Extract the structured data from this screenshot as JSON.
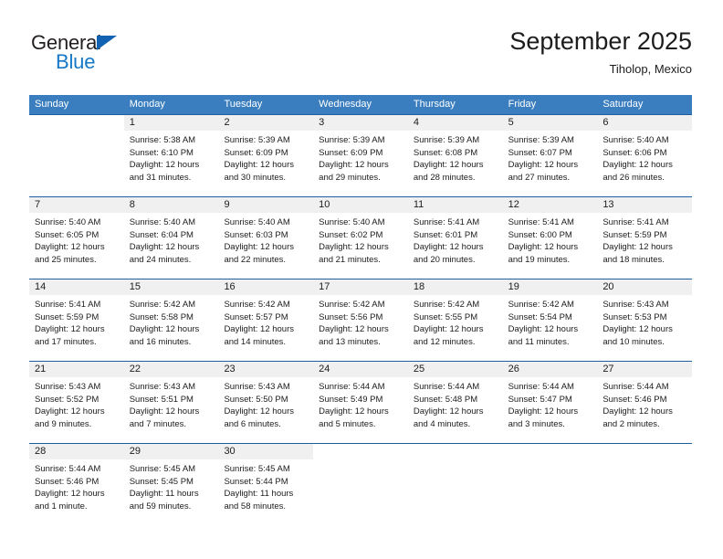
{
  "brand": {
    "name_part1": "General",
    "name_part2": "Blue",
    "triangle_color": "#1262b3",
    "blue_color": "#1678c8"
  },
  "header": {
    "month_title": "September 2025",
    "location": "Tiholop, Mexico"
  },
  "theme": {
    "header_row_bg": "#3a7ebf",
    "week_divider": "#1f5fa0",
    "day_band_bg": "#f0f0f0",
    "text": "#1c1c1c"
  },
  "weekdays": [
    "Sunday",
    "Monday",
    "Tuesday",
    "Wednesday",
    "Thursday",
    "Friday",
    "Saturday"
  ],
  "weeks": [
    {
      "days": [
        {
          "num": "",
          "empty": true,
          "lines": [
            "",
            "",
            "",
            ""
          ]
        },
        {
          "num": "1",
          "empty": false,
          "lines": [
            "Sunrise: 5:38 AM",
            "Sunset: 6:10 PM",
            "Daylight: 12 hours",
            "and 31 minutes."
          ]
        },
        {
          "num": "2",
          "empty": false,
          "lines": [
            "Sunrise: 5:39 AM",
            "Sunset: 6:09 PM",
            "Daylight: 12 hours",
            "and 30 minutes."
          ]
        },
        {
          "num": "3",
          "empty": false,
          "lines": [
            "Sunrise: 5:39 AM",
            "Sunset: 6:09 PM",
            "Daylight: 12 hours",
            "and 29 minutes."
          ]
        },
        {
          "num": "4",
          "empty": false,
          "lines": [
            "Sunrise: 5:39 AM",
            "Sunset: 6:08 PM",
            "Daylight: 12 hours",
            "and 28 minutes."
          ]
        },
        {
          "num": "5",
          "empty": false,
          "lines": [
            "Sunrise: 5:39 AM",
            "Sunset: 6:07 PM",
            "Daylight: 12 hours",
            "and 27 minutes."
          ]
        },
        {
          "num": "6",
          "empty": false,
          "lines": [
            "Sunrise: 5:40 AM",
            "Sunset: 6:06 PM",
            "Daylight: 12 hours",
            "and 26 minutes."
          ]
        }
      ]
    },
    {
      "days": [
        {
          "num": "7",
          "empty": false,
          "lines": [
            "Sunrise: 5:40 AM",
            "Sunset: 6:05 PM",
            "Daylight: 12 hours",
            "and 25 minutes."
          ]
        },
        {
          "num": "8",
          "empty": false,
          "lines": [
            "Sunrise: 5:40 AM",
            "Sunset: 6:04 PM",
            "Daylight: 12 hours",
            "and 24 minutes."
          ]
        },
        {
          "num": "9",
          "empty": false,
          "lines": [
            "Sunrise: 5:40 AM",
            "Sunset: 6:03 PM",
            "Daylight: 12 hours",
            "and 22 minutes."
          ]
        },
        {
          "num": "10",
          "empty": false,
          "lines": [
            "Sunrise: 5:40 AM",
            "Sunset: 6:02 PM",
            "Daylight: 12 hours",
            "and 21 minutes."
          ]
        },
        {
          "num": "11",
          "empty": false,
          "lines": [
            "Sunrise: 5:41 AM",
            "Sunset: 6:01 PM",
            "Daylight: 12 hours",
            "and 20 minutes."
          ]
        },
        {
          "num": "12",
          "empty": false,
          "lines": [
            "Sunrise: 5:41 AM",
            "Sunset: 6:00 PM",
            "Daylight: 12 hours",
            "and 19 minutes."
          ]
        },
        {
          "num": "13",
          "empty": false,
          "lines": [
            "Sunrise: 5:41 AM",
            "Sunset: 5:59 PM",
            "Daylight: 12 hours",
            "and 18 minutes."
          ]
        }
      ]
    },
    {
      "days": [
        {
          "num": "14",
          "empty": false,
          "lines": [
            "Sunrise: 5:41 AM",
            "Sunset: 5:59 PM",
            "Daylight: 12 hours",
            "and 17 minutes."
          ]
        },
        {
          "num": "15",
          "empty": false,
          "lines": [
            "Sunrise: 5:42 AM",
            "Sunset: 5:58 PM",
            "Daylight: 12 hours",
            "and 16 minutes."
          ]
        },
        {
          "num": "16",
          "empty": false,
          "lines": [
            "Sunrise: 5:42 AM",
            "Sunset: 5:57 PM",
            "Daylight: 12 hours",
            "and 14 minutes."
          ]
        },
        {
          "num": "17",
          "empty": false,
          "lines": [
            "Sunrise: 5:42 AM",
            "Sunset: 5:56 PM",
            "Daylight: 12 hours",
            "and 13 minutes."
          ]
        },
        {
          "num": "18",
          "empty": false,
          "lines": [
            "Sunrise: 5:42 AM",
            "Sunset: 5:55 PM",
            "Daylight: 12 hours",
            "and 12 minutes."
          ]
        },
        {
          "num": "19",
          "empty": false,
          "lines": [
            "Sunrise: 5:42 AM",
            "Sunset: 5:54 PM",
            "Daylight: 12 hours",
            "and 11 minutes."
          ]
        },
        {
          "num": "20",
          "empty": false,
          "lines": [
            "Sunrise: 5:43 AM",
            "Sunset: 5:53 PM",
            "Daylight: 12 hours",
            "and 10 minutes."
          ]
        }
      ]
    },
    {
      "days": [
        {
          "num": "21",
          "empty": false,
          "lines": [
            "Sunrise: 5:43 AM",
            "Sunset: 5:52 PM",
            "Daylight: 12 hours",
            "and 9 minutes."
          ]
        },
        {
          "num": "22",
          "empty": false,
          "lines": [
            "Sunrise: 5:43 AM",
            "Sunset: 5:51 PM",
            "Daylight: 12 hours",
            "and 7 minutes."
          ]
        },
        {
          "num": "23",
          "empty": false,
          "lines": [
            "Sunrise: 5:43 AM",
            "Sunset: 5:50 PM",
            "Daylight: 12 hours",
            "and 6 minutes."
          ]
        },
        {
          "num": "24",
          "empty": false,
          "lines": [
            "Sunrise: 5:44 AM",
            "Sunset: 5:49 PM",
            "Daylight: 12 hours",
            "and 5 minutes."
          ]
        },
        {
          "num": "25",
          "empty": false,
          "lines": [
            "Sunrise: 5:44 AM",
            "Sunset: 5:48 PM",
            "Daylight: 12 hours",
            "and 4 minutes."
          ]
        },
        {
          "num": "26",
          "empty": false,
          "lines": [
            "Sunrise: 5:44 AM",
            "Sunset: 5:47 PM",
            "Daylight: 12 hours",
            "and 3 minutes."
          ]
        },
        {
          "num": "27",
          "empty": false,
          "lines": [
            "Sunrise: 5:44 AM",
            "Sunset: 5:46 PM",
            "Daylight: 12 hours",
            "and 2 minutes."
          ]
        }
      ]
    },
    {
      "days": [
        {
          "num": "28",
          "empty": false,
          "lines": [
            "Sunrise: 5:44 AM",
            "Sunset: 5:46 PM",
            "Daylight: 12 hours",
            "and 1 minute."
          ]
        },
        {
          "num": "29",
          "empty": false,
          "lines": [
            "Sunrise: 5:45 AM",
            "Sunset: 5:45 PM",
            "Daylight: 11 hours",
            "and 59 minutes."
          ]
        },
        {
          "num": "30",
          "empty": false,
          "lines": [
            "Sunrise: 5:45 AM",
            "Sunset: 5:44 PM",
            "Daylight: 11 hours",
            "and 58 minutes."
          ]
        },
        {
          "num": "",
          "empty": true,
          "lines": [
            "",
            "",
            "",
            ""
          ]
        },
        {
          "num": "",
          "empty": true,
          "lines": [
            "",
            "",
            "",
            ""
          ]
        },
        {
          "num": "",
          "empty": true,
          "lines": [
            "",
            "",
            "",
            ""
          ]
        },
        {
          "num": "",
          "empty": true,
          "lines": [
            "",
            "",
            "",
            ""
          ]
        }
      ]
    }
  ]
}
